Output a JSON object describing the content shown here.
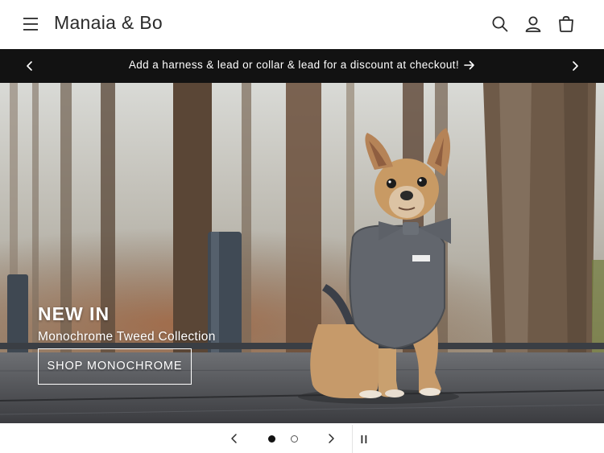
{
  "header": {
    "brand": "Manaia & Bo",
    "icons": [
      "menu-icon",
      "search-icon",
      "account-icon",
      "cart-icon"
    ]
  },
  "announcement": {
    "text": "Add a harness & lead or collar & lead for a discount at checkout!",
    "icons": [
      "chevron-left-icon",
      "arrow-right-icon",
      "chevron-right-icon"
    ]
  },
  "hero": {
    "title": "NEW IN",
    "subtitle": "Monochrome Tweed Collection",
    "button_label": "SHOP MONOCHROME"
  },
  "slideshow": {
    "slide_count": 2,
    "active_slide": 1,
    "icons": [
      "chevron-left-icon",
      "chevron-right-icon",
      "pause-icon"
    ]
  },
  "colors": {
    "announcement_bg": "#121212",
    "text": "#121212",
    "background": "#ffffff"
  }
}
